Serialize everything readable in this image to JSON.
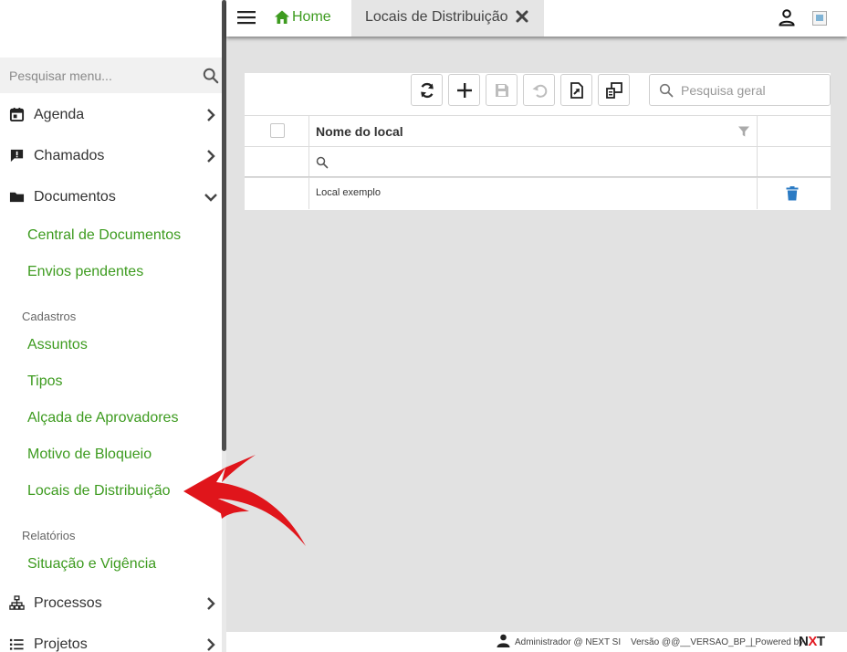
{
  "sidebar": {
    "search_placeholder": "Pesquisar menu...",
    "items": [
      {
        "label": "Agenda"
      },
      {
        "label": "Chamados"
      },
      {
        "label": "Documentos"
      },
      {
        "label": "Processos"
      },
      {
        "label": "Projetos"
      }
    ],
    "documentos_sub": [
      "Central de Documentos",
      "Envios pendentes"
    ],
    "section_cadastros": "Cadastros",
    "cadastros": [
      "Assuntos",
      "Tipos",
      "Alçada de Aprovadores",
      "Motivo de Bloqueio",
      "Locais de Distribuição"
    ],
    "section_relatorios": "Relatórios",
    "relatorios": [
      "Situação e Vigência"
    ]
  },
  "header": {
    "home_label": "Home",
    "active_tab_label": "Locais de Distribuição"
  },
  "toolbar": {
    "search_placeholder": "Pesquisa geral"
  },
  "grid": {
    "column_header": "Nome do local",
    "rows": [
      {
        "name": "Local exemplo"
      }
    ]
  },
  "footer": {
    "user": "Administrador @ NEXT SI",
    "version": "Versão @@__VERSAO_BP__",
    "powered": "| Powered by",
    "logo_n": "N",
    "logo_x": "X",
    "logo_t": "T"
  },
  "colors": {
    "accent_green": "#3d9b1f",
    "trash_blue": "#2b7bc4",
    "annotation_red": "#e0151b"
  }
}
